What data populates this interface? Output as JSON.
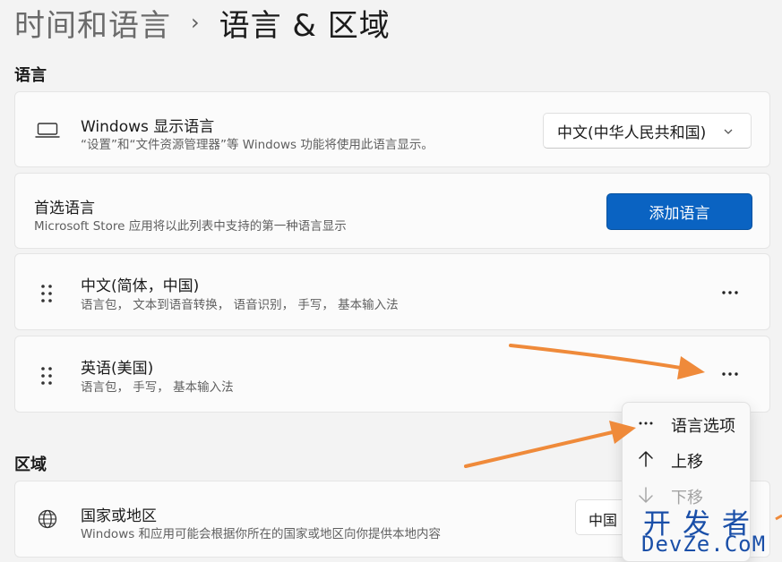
{
  "breadcrumb": {
    "parent": "时间和语言",
    "separator": "›",
    "current": "语言 & 区域"
  },
  "language_section": {
    "title": "语言",
    "display_language": {
      "title": "Windows 显示语言",
      "subtitle": "“设置”和“文件资源管理器”等 Windows 功能将使用此语言显示。",
      "selected_value": "中文(中华人民共和国)",
      "icon": "laptop-icon"
    },
    "preferred": {
      "title": "首选语言",
      "subtitle": "Microsoft Store 应用将以此列表中支持的第一种语言显示",
      "add_button_label": "添加语言"
    },
    "languages": [
      {
        "name": "中文(简体，中国)",
        "features": "语言包， 文本到语音转换， 语音识别， 手写， 基本输入法"
      },
      {
        "name": "英语(美国)",
        "features": "语言包， 手写， 基本输入法"
      }
    ]
  },
  "context_menu": {
    "items": [
      {
        "label": "语言选项",
        "icon": "more-horizontal-icon",
        "enabled": true
      },
      {
        "label": "上移",
        "icon": "arrow-up-icon",
        "enabled": true
      },
      {
        "label": "下移",
        "icon": "arrow-down-icon",
        "enabled": false
      }
    ]
  },
  "region_section": {
    "title": "区域",
    "country": {
      "title": "国家或地区",
      "subtitle": "Windows 和应用可能会根据你所在的国家或地区向你提供本地内容",
      "selected_value_partial": "中国",
      "icon": "globe-icon"
    }
  },
  "watermark": {
    "cn": "开发者",
    "en": "DevZe.CoM"
  },
  "colors": {
    "accent": "#0a63c2",
    "annotation_arrow": "#ef8a3a",
    "watermark": "#1a4fa8",
    "background": "#f3f3f3",
    "card": "#fbfbfb"
  }
}
